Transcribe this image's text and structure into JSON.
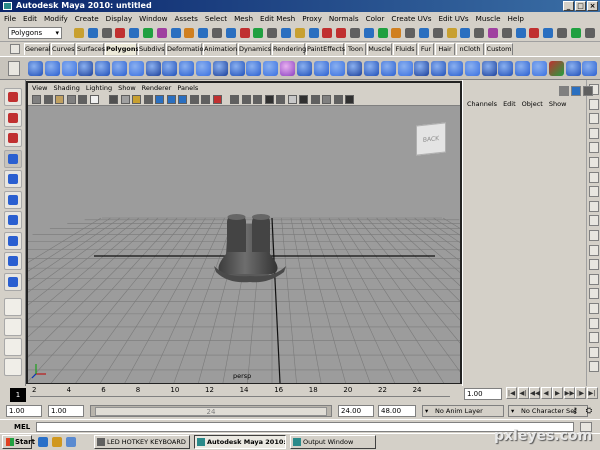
{
  "window": {
    "title": "Autodesk Maya 2010: untitled"
  },
  "menus": [
    "File",
    "Edit",
    "Modify",
    "Create",
    "Display",
    "Window",
    "Assets",
    "Select",
    "Mesh",
    "Edit Mesh",
    "Proxy",
    "Normals",
    "Color",
    "Create UVs",
    "Edit UVs",
    "Muscle",
    "Help"
  ],
  "status_line": {
    "mode": "Polygons"
  },
  "shelf_tabs": [
    "General",
    "Curves",
    "Surfaces",
    "Polygons",
    "Subdivs",
    "Deformation",
    "Animation",
    "Dynamics",
    "Rendering",
    "PaintEffects",
    "Toon",
    "Muscle",
    "Fluids",
    "Fur",
    "Hair",
    "nCloth",
    "Custom"
  ],
  "active_shelf": "Polygons",
  "panel_menu": [
    "View",
    "Shading",
    "Lighting",
    "Show",
    "Renderer",
    "Panels"
  ],
  "viewport": {
    "camera_label": "persp",
    "viewcube_label": "BACK"
  },
  "channel_box": {
    "tabs": [
      "Channels",
      "Edit",
      "Object",
      "Show"
    ]
  },
  "time_slider": {
    "ticks": [
      "2",
      "4",
      "6",
      "8",
      "10",
      "12",
      "14",
      "16",
      "18",
      "20",
      "22",
      "24"
    ],
    "current_frame": "1",
    "current_field": "1.00"
  },
  "range": {
    "start": "1.00",
    "inner_start": "1.00",
    "handle": "24",
    "inner_end": "24.00",
    "end": "48.00",
    "anim_layer": "No Anim Layer",
    "character_set": "No Character Set"
  },
  "command_line": {
    "label": "MEL"
  },
  "taskbar": {
    "start": "Start",
    "tasks": [
      "LED HOTKEY KEYBOARD",
      "Autodesk Maya 2010:...",
      "Output Window"
    ]
  },
  "watermark": "pxleyes.com"
}
